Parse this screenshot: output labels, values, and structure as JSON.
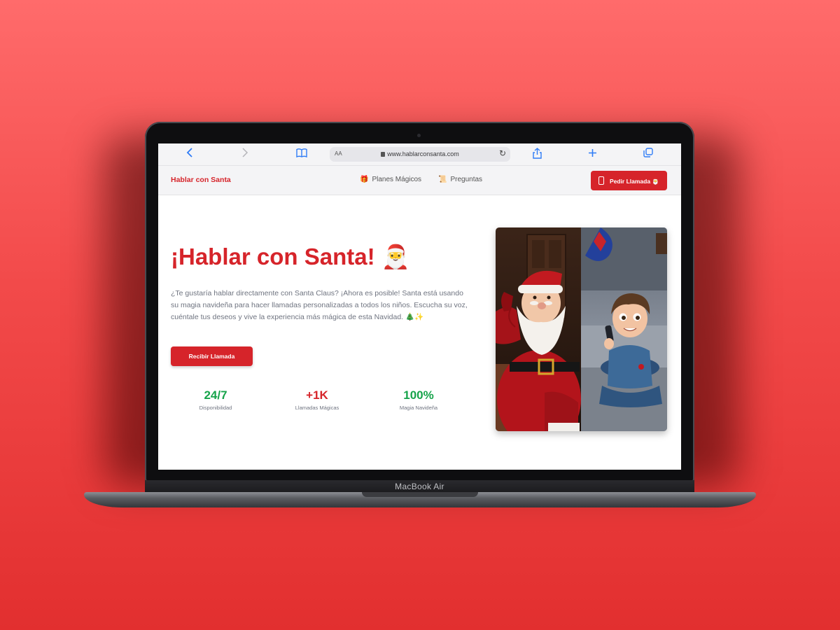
{
  "device": {
    "label": "MacBook Air"
  },
  "browser": {
    "url": "www.hablarconsanta.com",
    "aa_label": "AA",
    "icons": [
      "back-icon",
      "forward-icon",
      "bookmarks-icon",
      "reload-icon",
      "share-icon",
      "new-tab-icon",
      "tabs-icon"
    ]
  },
  "nav": {
    "brand": "Hablar con Santa",
    "links": [
      {
        "emoji": "🎁",
        "label": "Planes Mágicos"
      },
      {
        "emoji": "📜",
        "label": "Preguntas"
      }
    ],
    "cta_label": "Pedir Llamada 🎅"
  },
  "hero": {
    "title": "¡Hablar con Santa! 🎅",
    "description": "¿Te gustaría hablar directamente con Santa Claus? ¡Ahora es posible! Santa está usando su magia navideña para hacer llamadas personalizadas a todos los niños. Escucha su voz, cuéntale tus deseos y vive la experiencia más mágica de esta Navidad. 🎄✨",
    "cta_label": "Recibir Llamada"
  },
  "stats": [
    {
      "value": "24/7",
      "label": "Disponibilidad",
      "color": "#16a34a"
    },
    {
      "value": "+1K",
      "label": "Llamadas Mágicas",
      "color": "#d6242a"
    },
    {
      "value": "100%",
      "label": "Magia Navideña",
      "color": "#16a34a"
    }
  ],
  "colors": {
    "brand_red": "#d6242a",
    "accent_green": "#16a34a",
    "background": "#f24a4a"
  }
}
